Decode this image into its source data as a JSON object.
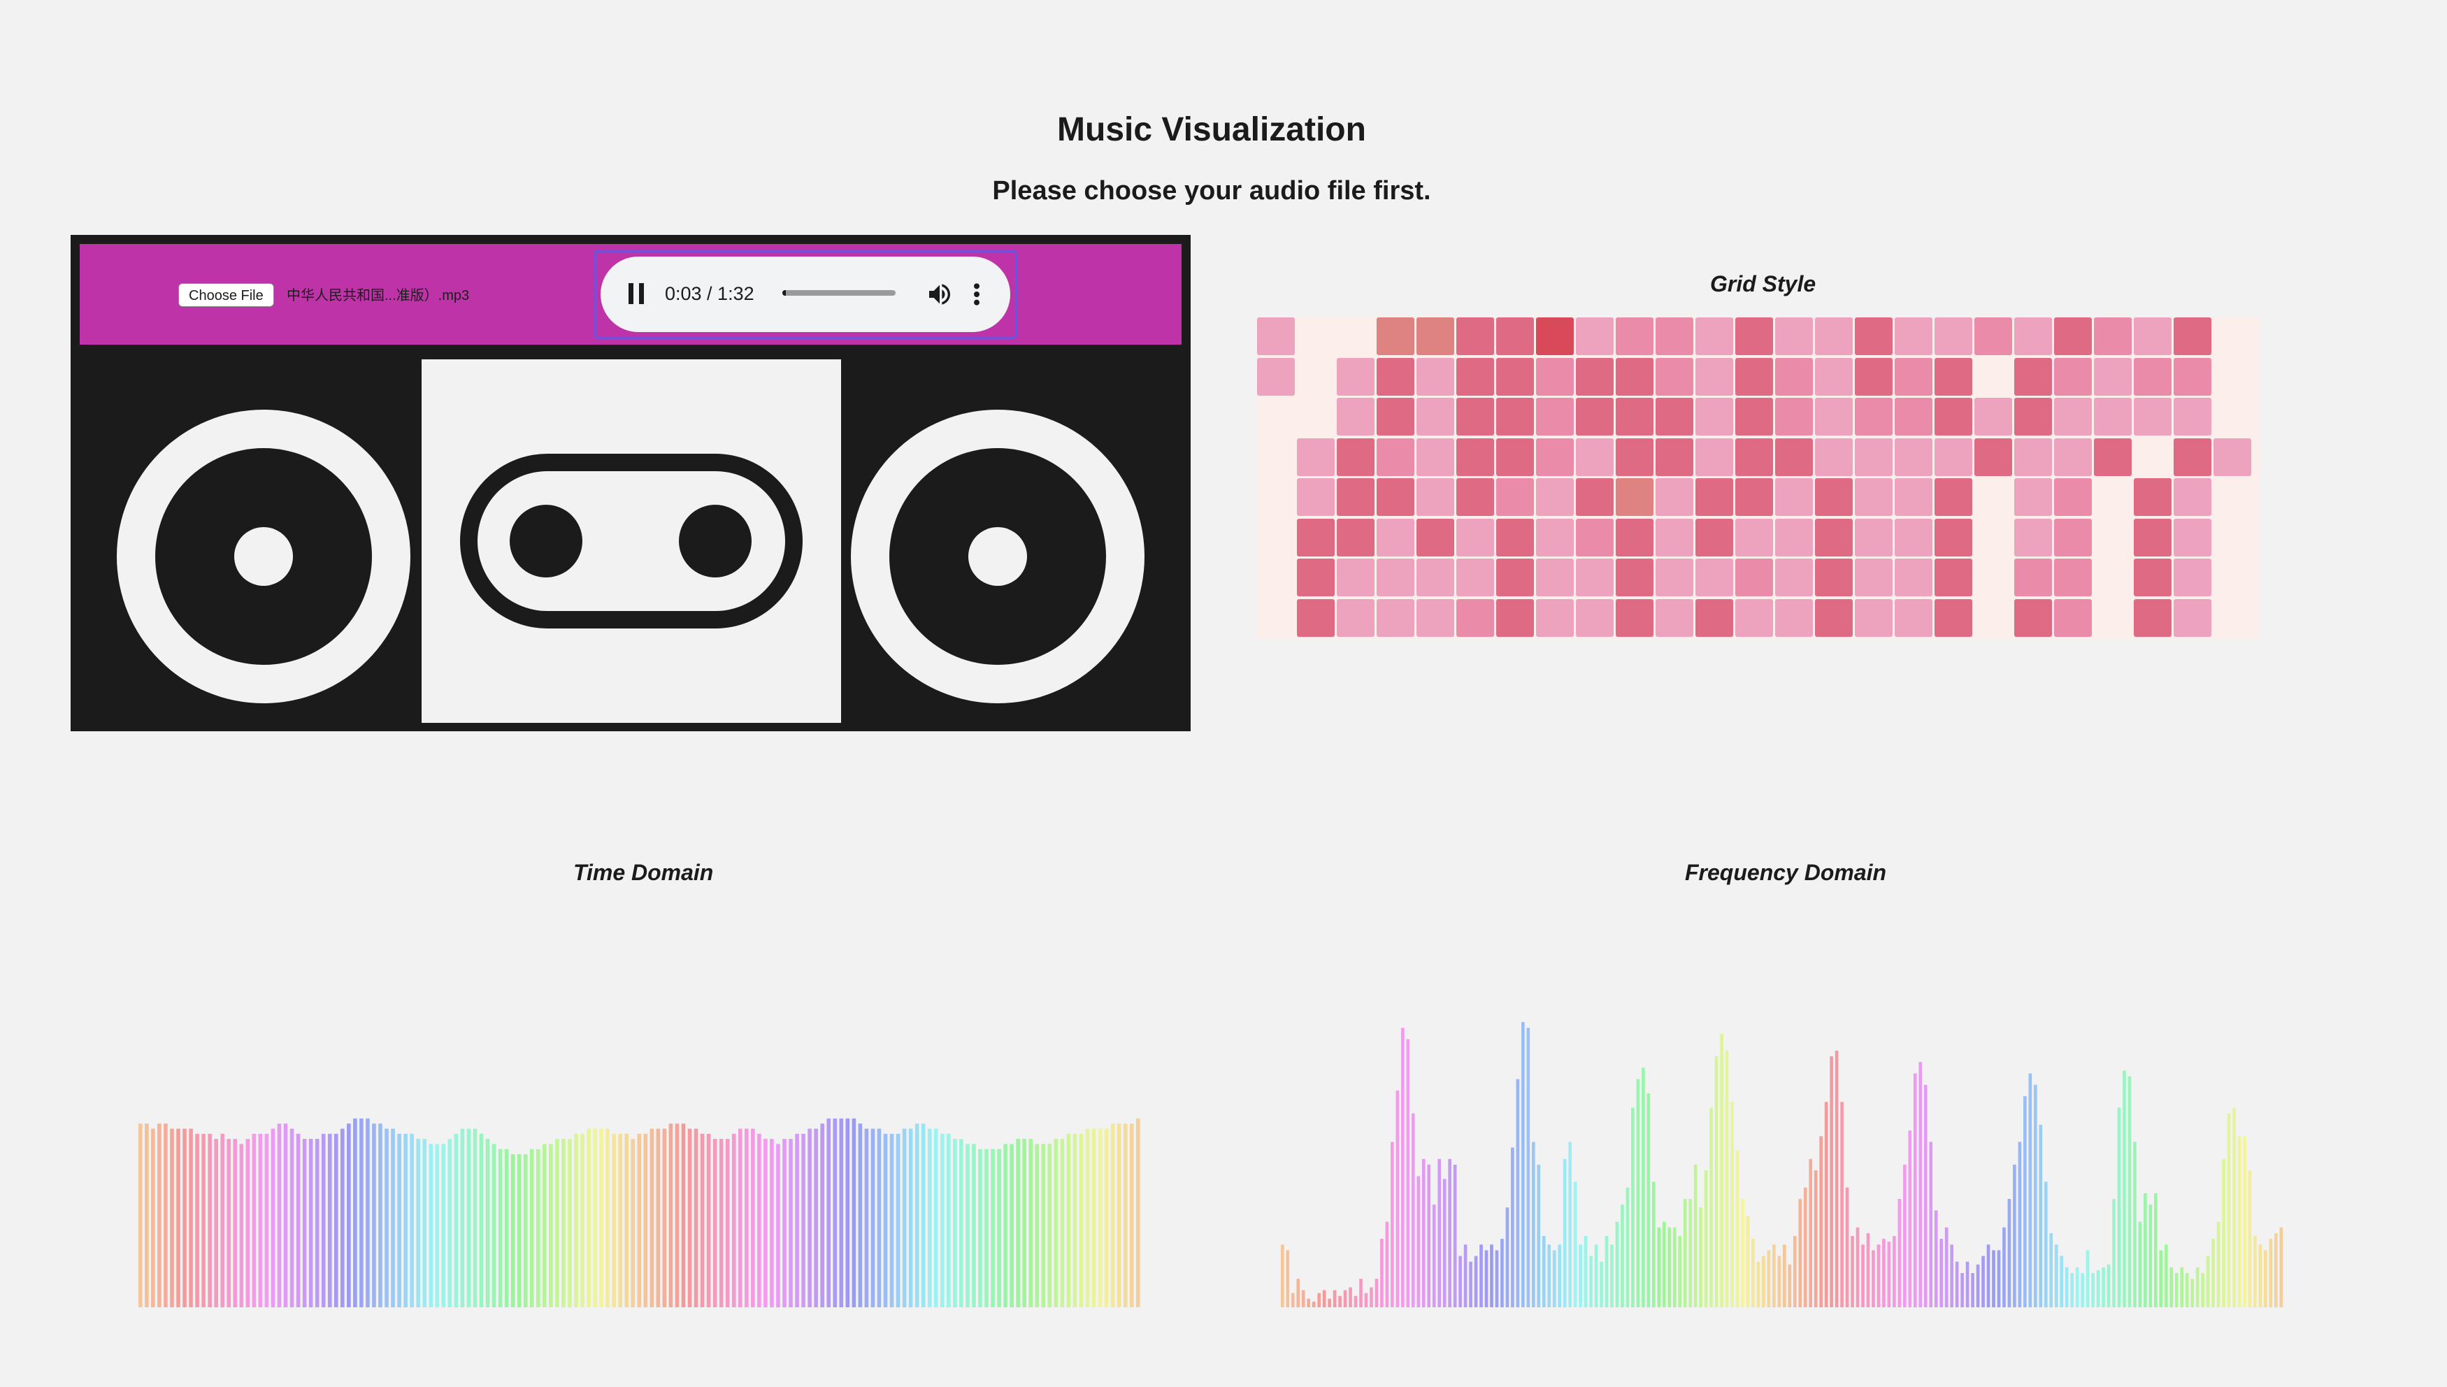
{
  "page": {
    "title": "Music Visualization",
    "subtitle": "Please choose your audio file first."
  },
  "player": {
    "file_button": "Choose File",
    "file_name": "中华人民共和国...准版）.mp3",
    "time": "0:03 / 1:32",
    "progress": 0.033
  },
  "sections": {
    "grid": "Grid Style",
    "time": "Time Domain",
    "freq": "Frequency Domain"
  },
  "icons": {
    "pause": "pause-icon",
    "volume": "volume-icon",
    "more": "more-options-icon"
  },
  "colors": {
    "boombox_body": "#1b1b1b",
    "boombox_bar": "#bf33a8",
    "focus_ring": "#7650d8",
    "grid_palette": [
      "#eda3bd",
      "#ea8ca9",
      "#df6a84",
      "#d84a5a",
      "#de8282"
    ]
  },
  "grid_levels": [
    [
      1,
      0,
      0,
      4,
      4,
      5,
      3,
      6,
      1,
      2,
      2,
      1,
      5,
      1,
      1,
      3,
      1,
      1,
      2,
      1,
      5,
      2,
      1,
      3
    ],
    [
      1,
      0,
      1,
      3,
      1,
      3,
      5,
      2,
      3,
      3,
      2,
      1,
      3,
      2,
      1,
      5,
      2,
      3,
      0,
      3,
      2,
      1,
      2,
      2
    ],
    [
      0,
      0,
      1,
      3,
      1,
      3,
      5,
      2,
      3,
      3,
      3,
      1,
      3,
      2,
      1,
      2,
      2,
      5,
      1,
      3,
      1,
      1,
      1,
      1
    ],
    [
      0,
      1,
      3,
      2,
      1,
      3,
      5,
      2,
      1,
      5,
      3,
      1,
      3,
      3,
      1,
      1,
      1,
      1,
      5,
      1,
      1,
      5,
      0,
      3,
      1
    ],
    [
      0,
      1,
      3,
      3,
      1,
      5,
      2,
      1,
      3,
      4,
      1,
      5,
      3,
      1,
      3,
      1,
      1,
      3,
      0,
      1,
      2,
      0,
      5,
      1
    ],
    [
      0,
      3,
      3,
      1,
      3,
      1,
      3,
      1,
      2,
      3,
      1,
      3,
      1,
      1,
      5,
      1,
      1,
      5,
      0,
      1,
      2,
      0,
      5,
      1
    ],
    [
      0,
      3,
      1,
      1,
      1,
      1,
      3,
      1,
      1,
      3,
      1,
      1,
      2,
      1,
      3,
      1,
      1,
      5,
      0,
      2,
      2,
      0,
      5,
      1
    ],
    [
      0,
      5,
      1,
      1,
      1,
      2,
      3,
      1,
      1,
      3,
      1,
      3,
      1,
      1,
      3,
      1,
      1,
      3,
      0,
      3,
      2,
      0,
      5,
      1
    ]
  ],
  "time_domain": [
    0.36,
    0.36,
    0.35,
    0.36,
    0.36,
    0.35,
    0.35,
    0.35,
    0.35,
    0.34,
    0.34,
    0.34,
    0.33,
    0.34,
    0.33,
    0.33,
    0.32,
    0.33,
    0.34,
    0.34,
    0.34,
    0.35,
    0.36,
    0.36,
    0.35,
    0.34,
    0.33,
    0.33,
    0.33,
    0.34,
    0.34,
    0.34,
    0.35,
    0.36,
    0.37,
    0.37,
    0.37,
    0.36,
    0.36,
    0.35,
    0.35,
    0.34,
    0.34,
    0.34,
    0.33,
    0.33,
    0.32,
    0.32,
    0.32,
    0.33,
    0.34,
    0.35,
    0.35,
    0.35,
    0.34,
    0.33,
    0.32,
    0.31,
    0.31,
    0.3,
    0.3,
    0.3,
    0.31,
    0.31,
    0.32,
    0.32,
    0.33,
    0.33,
    0.33,
    0.34,
    0.34,
    0.35,
    0.35,
    0.35,
    0.35,
    0.34,
    0.34,
    0.34,
    0.33,
    0.34,
    0.34,
    0.35,
    0.35,
    0.35,
    0.36,
    0.36,
    0.36,
    0.35,
    0.35,
    0.34,
    0.34,
    0.33,
    0.33,
    0.33,
    0.34,
    0.35,
    0.35,
    0.35,
    0.34,
    0.33,
    0.33,
    0.32,
    0.33,
    0.33,
    0.34,
    0.34,
    0.35,
    0.35,
    0.36,
    0.37,
    0.37,
    0.37,
    0.37,
    0.37,
    0.36,
    0.35,
    0.35,
    0.35,
    0.34,
    0.34,
    0.34,
    0.35,
    0.35,
    0.36,
    0.36,
    0.35,
    0.35,
    0.34,
    0.34,
    0.33,
    0.33,
    0.32,
    0.32,
    0.31,
    0.31,
    0.31,
    0.31,
    0.32,
    0.32,
    0.33,
    0.33,
    0.33,
    0.32,
    0.32,
    0.32,
    0.33,
    0.33,
    0.34,
    0.34,
    0.34,
    0.35,
    0.35,
    0.35,
    0.35,
    0.36,
    0.36,
    0.36,
    0.36,
    0.37
  ],
  "freq_domain": [
    0.22,
    0.2,
    0.05,
    0.1,
    0.06,
    0.03,
    0.02,
    0.05,
    0.06,
    0.03,
    0.06,
    0.04,
    0.06,
    0.07,
    0.04,
    0.1,
    0.05,
    0.07,
    0.1,
    0.24,
    0.3,
    0.58,
    0.76,
    0.98,
    0.94,
    0.68,
    0.46,
    0.52,
    0.5,
    0.36,
    0.52,
    0.45,
    0.52,
    0.5,
    0.18,
    0.22,
    0.16,
    0.18,
    0.22,
    0.2,
    0.22,
    0.2,
    0.24,
    0.35,
    0.56,
    0.8,
    1.0,
    0.98,
    0.58,
    0.5,
    0.25,
    0.22,
    0.2,
    0.22,
    0.52,
    0.58,
    0.44,
    0.22,
    0.25,
    0.18,
    0.22,
    0.16,
    0.25,
    0.22,
    0.3,
    0.36,
    0.42,
    0.7,
    0.8,
    0.84,
    0.75,
    0.44,
    0.28,
    0.3,
    0.28,
    0.28,
    0.25,
    0.38,
    0.38,
    0.5,
    0.35,
    0.48,
    0.7,
    0.88,
    0.96,
    0.9,
    0.72,
    0.55,
    0.38,
    0.32,
    0.24,
    0.16,
    0.18,
    0.2,
    0.22,
    0.18,
    0.22,
    0.15,
    0.25,
    0.38,
    0.42,
    0.52,
    0.48,
    0.6,
    0.72,
    0.88,
    0.9,
    0.72,
    0.42,
    0.25,
    0.28,
    0.22,
    0.26,
    0.2,
    0.22,
    0.24,
    0.23,
    0.25,
    0.38,
    0.5,
    0.62,
    0.82,
    0.86,
    0.78,
    0.58,
    0.34,
    0.24,
    0.28,
    0.22,
    0.16,
    0.12,
    0.16,
    0.12,
    0.15,
    0.18,
    0.22,
    0.2,
    0.2,
    0.28,
    0.38,
    0.5,
    0.58,
    0.74,
    0.82,
    0.78,
    0.64,
    0.44,
    0.26,
    0.22,
    0.18,
    0.14,
    0.12,
    0.14,
    0.12,
    0.2,
    0.12,
    0.13,
    0.14,
    0.15,
    0.38,
    0.7,
    0.83,
    0.81,
    0.58,
    0.3,
    0.4,
    0.36,
    0.4,
    0.2,
    0.22,
    0.14,
    0.12,
    0.14,
    0.12,
    0.1,
    0.14,
    0.12,
    0.18,
    0.24,
    0.3,
    0.52,
    0.68,
    0.7,
    0.6,
    0.6,
    0.48,
    0.25,
    0.22,
    0.2,
    0.24,
    0.26,
    0.28
  ]
}
